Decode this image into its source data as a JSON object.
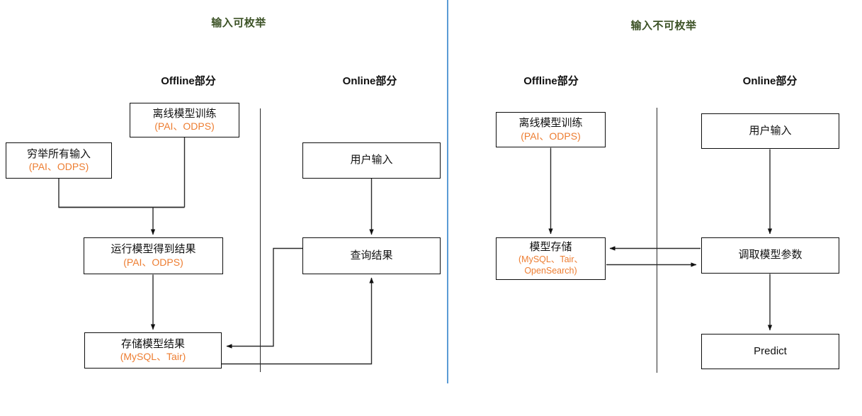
{
  "diagram": {
    "title_left": "输入可枚举",
    "title_right": "输入不可枚举",
    "accent_orange": "#ED7D31",
    "title_green": "#3c5226",
    "divider_blue": "#5B9BD5",
    "line_color": "#2b2b2b"
  },
  "left_panel": {
    "title": "输入可枚举",
    "columns": {
      "offline": "Offline部分",
      "online": "Online部分"
    },
    "nodes": {
      "offline_train": {
        "main": "离线模型训练",
        "sub": "(PAI、ODPS)"
      },
      "enumerate_inputs": {
        "main": "穷举所有输入",
        "sub": "(PAI、ODPS)"
      },
      "run_model": {
        "main": "运行模型得到结果",
        "sub": "(PAI、ODPS)"
      },
      "store_result": {
        "main": "存储模型结果",
        "sub": "(MySQL、Tair)"
      },
      "user_input": {
        "main": "用户输入",
        "sub": ""
      },
      "query_result": {
        "main": "查询结果",
        "sub": ""
      }
    }
  },
  "right_panel": {
    "title": "输入不可枚举",
    "columns": {
      "offline": "Offline部分",
      "online": "Online部分"
    },
    "nodes": {
      "offline_train": {
        "main": "离线模型训练",
        "sub": "(PAI、ODPS)"
      },
      "model_store": {
        "main": "模型存储",
        "sub": "(MySQL、Tair、",
        "sub2": "OpenSearch)"
      },
      "user_input": {
        "main": "用户输入",
        "sub": ""
      },
      "fetch_params": {
        "main": "调取模型参数",
        "sub": ""
      },
      "predict": {
        "main": "Predict",
        "sub": ""
      }
    }
  }
}
